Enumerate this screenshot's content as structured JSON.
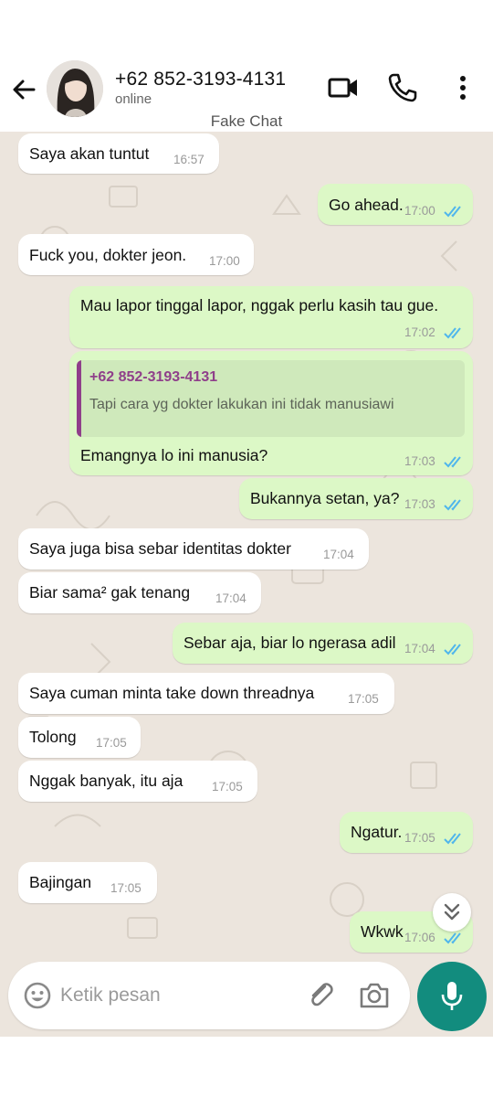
{
  "header": {
    "contact_name": "+62 852-3193-4131",
    "status": "online",
    "watermark": "Fake Chat",
    "icons": [
      "back-arrow-icon",
      "video-call-icon",
      "phone-icon",
      "more-vertical-icon"
    ]
  },
  "messages": [
    {
      "dir": "in",
      "text": "Saya akan tuntut",
      "time": "16:57"
    },
    {
      "dir": "out",
      "text": "Go ahead.",
      "time": "17:00",
      "read": true
    },
    {
      "dir": "in",
      "text": "Fuck you, dokter jeon.",
      "time": "17:00"
    },
    {
      "dir": "out",
      "text": "Mau lapor tinggal lapor, nggak perlu kasih tau gue.",
      "time": "17:02",
      "read": true
    },
    {
      "dir": "out",
      "text": "Emangnya lo ini manusia?",
      "time": "17:03",
      "read": true,
      "reply_to": {
        "name": "+62 852-3193-4131",
        "text": "Tapi cara yg dokter lakukan ini tidak manusiawi"
      }
    },
    {
      "dir": "out",
      "text": "Bukannya setan, ya?",
      "time": "17:03",
      "read": true
    },
    {
      "dir": "in",
      "text": "Saya juga bisa sebar identitas dokter",
      "time": "17:04"
    },
    {
      "dir": "in",
      "text": "Biar sama² gak tenang",
      "time": "17:04"
    },
    {
      "dir": "out",
      "text": "Sebar aja, biar lo ngerasa adil",
      "time": "17:04",
      "read": true
    },
    {
      "dir": "in",
      "text": "Saya cuman minta take down threadnya",
      "time": "17:05"
    },
    {
      "dir": "in",
      "text": "Tolong",
      "time": "17:05"
    },
    {
      "dir": "in",
      "text": "Nggak banyak, itu aja",
      "time": "17:05"
    },
    {
      "dir": "out",
      "text": "Ngatur.",
      "time": "17:05",
      "read": true
    },
    {
      "dir": "in",
      "text": "Bajingan",
      "time": "17:05"
    },
    {
      "dir": "out",
      "text": "Wkwk",
      "time": "17:06",
      "read": true
    }
  ],
  "composer": {
    "placeholder": "Ketik pesan",
    "icons": [
      "emoji-icon",
      "attach-icon",
      "camera-icon",
      "mic-icon"
    ]
  },
  "colors": {
    "chat_background": "#ece5dd",
    "incoming_bubble": "#ffffff",
    "outgoing_bubble": "#dcf8c6",
    "read_ticks": "#4fb6ec",
    "accent": "#128c7e",
    "reply_accent": "#8f3f8a"
  }
}
